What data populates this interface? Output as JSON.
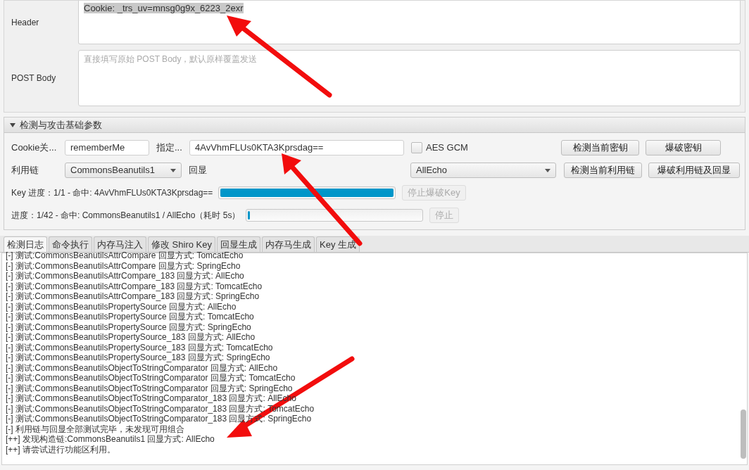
{
  "request": {
    "header": {
      "label": "Header",
      "value": "Cookie: _trs_uv=mnsg0g9x_6223_2exr",
      "value_selected": true
    },
    "post_body": {
      "label": "POST Body",
      "placeholder": "直接填写原始 POST Body，默认原样覆盖发送"
    }
  },
  "params_panel": {
    "title": "检测与攻击基础参数",
    "expanded": true,
    "cookie_name": {
      "label": "Cookie关...",
      "value": "rememberMe"
    },
    "key": {
      "label": "指定...",
      "value": "4AvVhmFLUs0KTA3Kprsdag=="
    },
    "aes_gcm": {
      "label": "AES GCM",
      "checked": false
    },
    "chain": {
      "label": "利用链",
      "value": "CommonsBeanutils1"
    },
    "echo": {
      "label": "回显",
      "value": "AllEcho"
    },
    "buttons": [
      {
        "label": "检测当前密钥",
        "disabled": false
      },
      {
        "label": "爆破密钥",
        "disabled": false
      },
      {
        "label": "检测当前利用链",
        "disabled": false
      },
      {
        "label": "爆破利用链及回显",
        "disabled": false
      }
    ],
    "key_progress": {
      "label": "Key 进度：1/1 - 命中: 4AvVhmFLUs0KTA3Kprsdag==",
      "level": 1.0,
      "stop_button": {
        "label": "停止爆破Key",
        "disabled": true
      }
    },
    "chain_progress": {
      "label": "进度：1/42 - 命中: CommonsBeanutils1 / AllEcho（耗时 5s）",
      "level": 0.01,
      "stop_button": {
        "label": "停止",
        "disabled": true
      }
    }
  },
  "tabs": [
    {
      "label": "检测日志",
      "selected": true
    },
    {
      "label": "命令执行",
      "selected": false
    },
    {
      "label": "内存马注入",
      "selected": false
    },
    {
      "label": "修改 Shiro Key",
      "selected": false
    },
    {
      "label": "回显生成",
      "selected": false
    },
    {
      "label": "内存马生成",
      "selected": false
    },
    {
      "label": "Key 生成",
      "selected": false
    }
  ],
  "log_lines": [
    "[-] 测试:CommonsBeanutilsAttrCompare  回显方式: TomcatEcho",
    "[-] 测试:CommonsBeanutilsAttrCompare  回显方式: SpringEcho",
    "[-] 测试:CommonsBeanutilsAttrCompare_183  回显方式: AllEcho",
    "[-] 测试:CommonsBeanutilsAttrCompare_183  回显方式: TomcatEcho",
    "[-] 测试:CommonsBeanutilsAttrCompare_183  回显方式: SpringEcho",
    "[-] 测试:CommonsBeanutilsPropertySource  回显方式: AllEcho",
    "[-] 测试:CommonsBeanutilsPropertySource  回显方式: TomcatEcho",
    "[-] 测试:CommonsBeanutilsPropertySource  回显方式: SpringEcho",
    "[-] 测试:CommonsBeanutilsPropertySource_183  回显方式: AllEcho",
    "[-] 测试:CommonsBeanutilsPropertySource_183  回显方式: TomcatEcho",
    "[-] 测试:CommonsBeanutilsPropertySource_183  回显方式: SpringEcho",
    "[-] 测试:CommonsBeanutilsObjectToStringComparator  回显方式: AllEcho",
    "[-] 测试:CommonsBeanutilsObjectToStringComparator  回显方式: TomcatEcho",
    "[-] 测试:CommonsBeanutilsObjectToStringComparator  回显方式: SpringEcho",
    "[-] 测试:CommonsBeanutilsObjectToStringComparator_183  回显方式: AllEcho",
    "[-] 测试:CommonsBeanutilsObjectToStringComparator_183  回显方式: TomcatEcho",
    "[-] 测试:CommonsBeanutilsObjectToStringComparator_183  回显方式: SpringEcho",
    "[-] 利用链与回显全部测试完毕，未发现可用组合",
    "[++] 发现构造链:CommonsBeanutils1  回显方式: AllEcho",
    "[++] 请尝试进行功能区利用。"
  ]
}
